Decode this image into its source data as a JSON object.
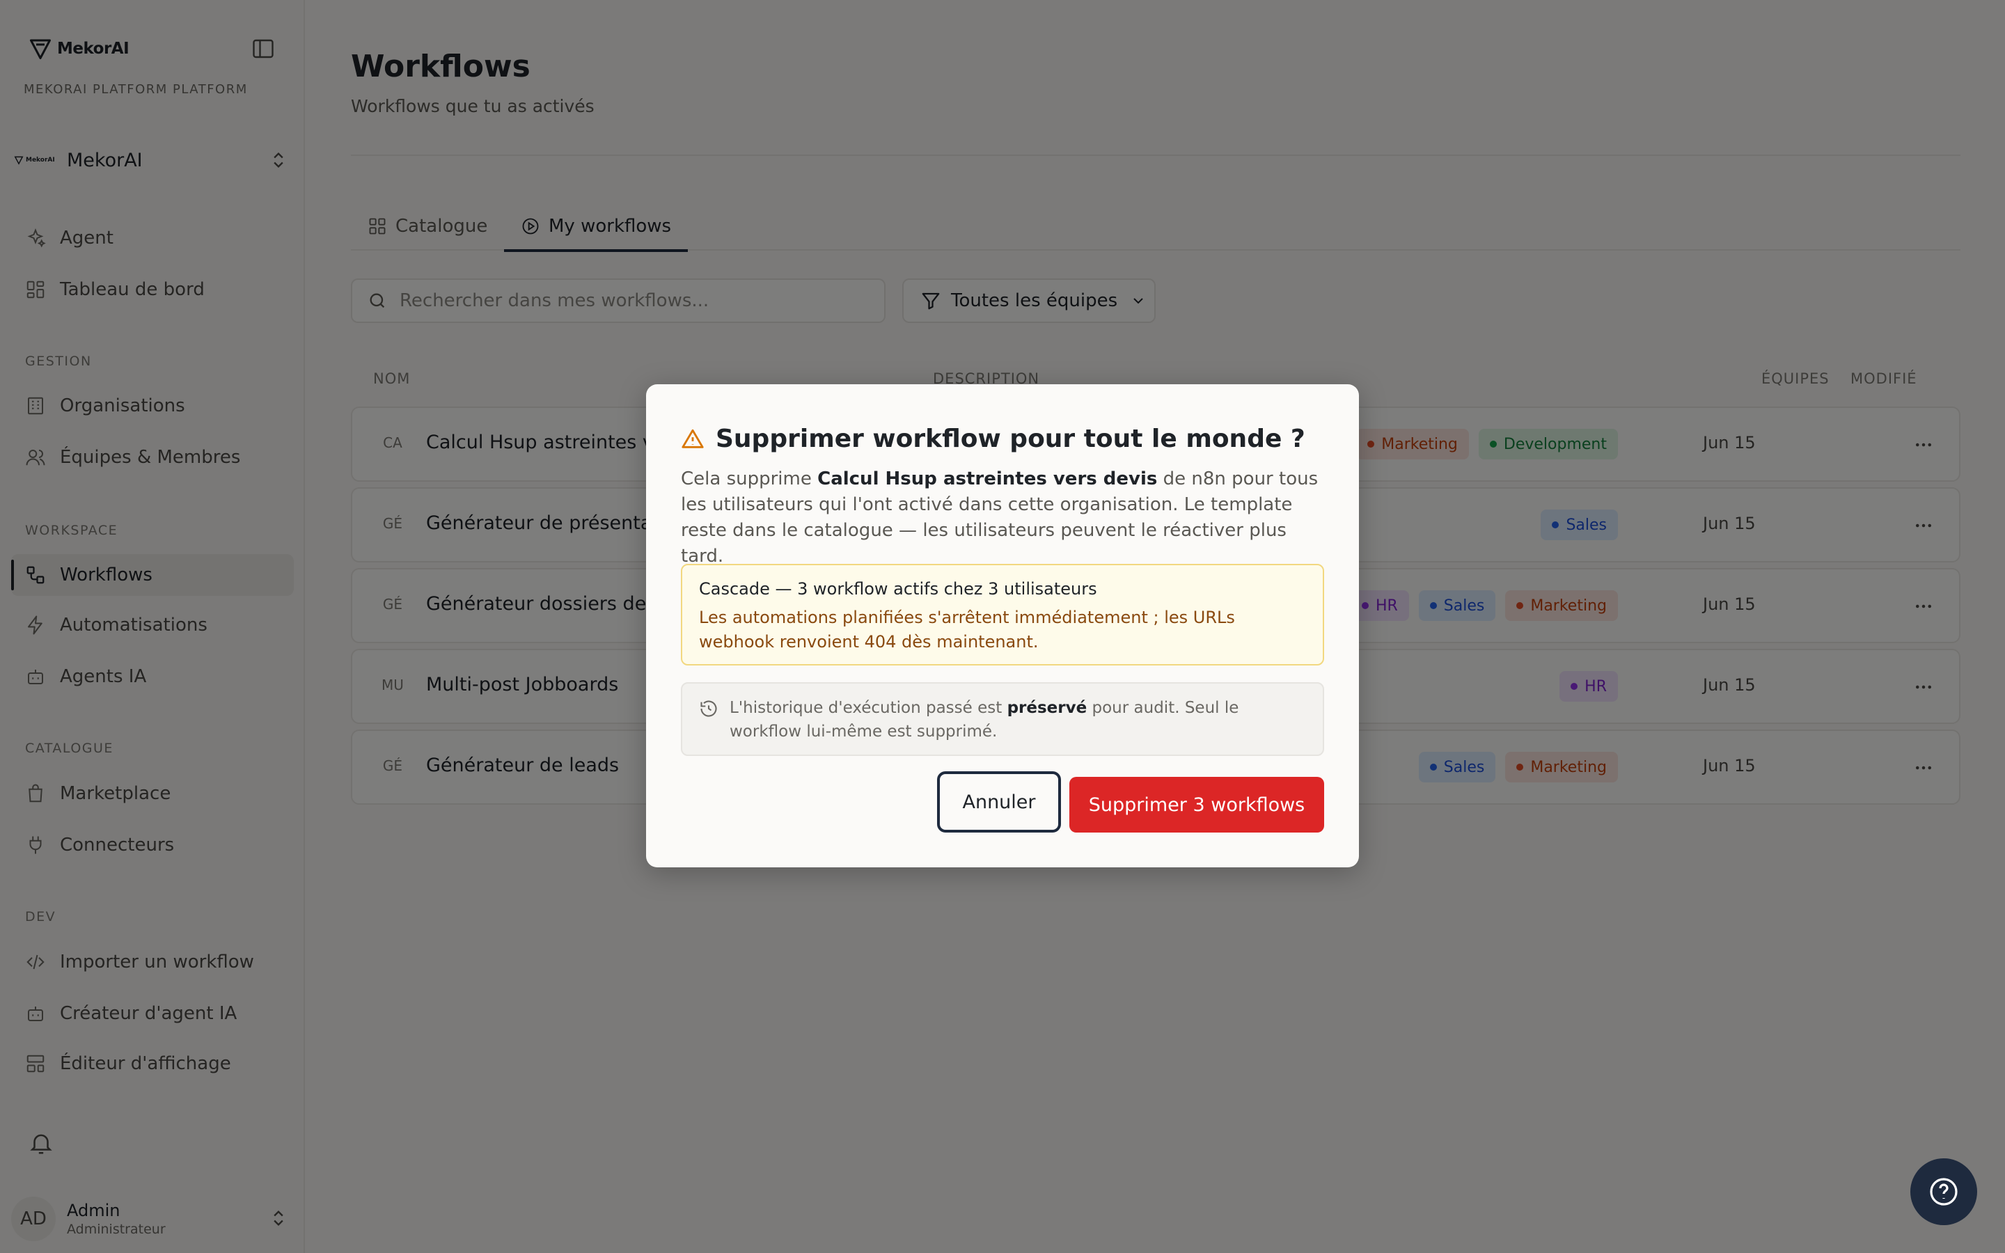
{
  "sidebar": {
    "logo_text": "MekorAI",
    "platform_label": "MEKORAI PLATFORM PLATFORM",
    "org": {
      "logo_text": "MekorAI",
      "name": "MekorAI"
    },
    "items": [
      {
        "label": "Agent"
      },
      {
        "label": "Tableau de bord"
      },
      {
        "label": "Organisations"
      },
      {
        "label": "Équipes & Membres"
      },
      {
        "label": "Workflows"
      },
      {
        "label": "Automatisations"
      },
      {
        "label": "Agents IA"
      },
      {
        "label": "Marketplace"
      },
      {
        "label": "Connecteurs"
      },
      {
        "label": "Importer un workflow"
      },
      {
        "label": "Créateur d'agent IA"
      },
      {
        "label": "Éditeur d'affichage"
      }
    ],
    "sections": [
      "GESTION",
      "WORKSPACE",
      "CATALOGUE",
      "DEV"
    ],
    "user": {
      "initials": "AD",
      "name": "Admin",
      "role": "Administrateur"
    }
  },
  "main": {
    "title": "Workflows",
    "subtitle": "Workflows que tu as activés",
    "tabs": [
      {
        "label": "Catalogue"
      },
      {
        "label": "My workflows"
      }
    ],
    "search": {
      "placeholder": "Rechercher dans mes workflows..."
    },
    "filter": {
      "label": "Toutes les équipes"
    },
    "table": {
      "columns": [
        "NOM",
        "DESCRIPTION",
        "ÉQUIPES",
        "MODIFIÉ"
      ],
      "rows": [
        {
          "initials": "CA",
          "name": "Calcul Hsup astreintes ver",
          "tags": [
            "Marketing",
            "Development"
          ],
          "modified": "Jun 15"
        },
        {
          "initials": "GÉ",
          "name": "Générateur de présentatio",
          "tags": [
            "Sales"
          ],
          "modified": "Jun 15"
        },
        {
          "initials": "GÉ",
          "name": "Générateur dossiers de co",
          "tags": [
            "HR",
            "Sales",
            "Marketing"
          ],
          "modified": "Jun 15"
        },
        {
          "initials": "MU",
          "name": "Multi-post Jobboards",
          "tags": [
            "HR"
          ],
          "modified": "Jun 15"
        },
        {
          "initials": "GÉ",
          "name": "Générateur de leads",
          "tags": [
            "Sales",
            "Marketing"
          ],
          "modified": "Jun 15"
        }
      ]
    }
  },
  "tag_colors": {
    "Marketing": {
      "bg": "#f9e2dc",
      "dot": "#e04a24",
      "text": "#c2410c"
    },
    "Development": {
      "bg": "#dcf2e0",
      "dot": "#16a34a",
      "text": "#15803d"
    },
    "Sales": {
      "bg": "#dbeafc",
      "dot": "#2563eb",
      "text": "#1d4ed8"
    },
    "HR": {
      "bg": "#efe1fa",
      "dot": "#9333ea",
      "text": "#7e22ce"
    }
  },
  "modal": {
    "title": "Supprimer workflow pour tout le monde ?",
    "desc_prefix": "Cela supprime ",
    "desc_workflow": "Calcul Hsup astreintes vers devis",
    "desc_suffix": " de n8n pour tous les utilisateurs qui l'ont activé dans cette organisation. Le template reste dans le catalogue — les utilisateurs peuvent le réactiver plus tard.",
    "cascade_title": "Cascade — 3 workflow actifs chez 3 utilisateurs",
    "cascade_text": "Les automations planifiées s'arrêtent immédiatement ; les URLs webhook renvoient 404 dès maintenant.",
    "history_prefix": "L'historique d'exécution passé est ",
    "history_bold": "préservé",
    "history_suffix": " pour audit. Seul le workflow lui-même est supprimé.",
    "cancel_label": "Annuler",
    "delete_label": "Supprimer 3 workflows"
  },
  "colors": {
    "accent_dark": "#1e2a3e",
    "danger": "#dc2626",
    "warning": "#d97706"
  }
}
